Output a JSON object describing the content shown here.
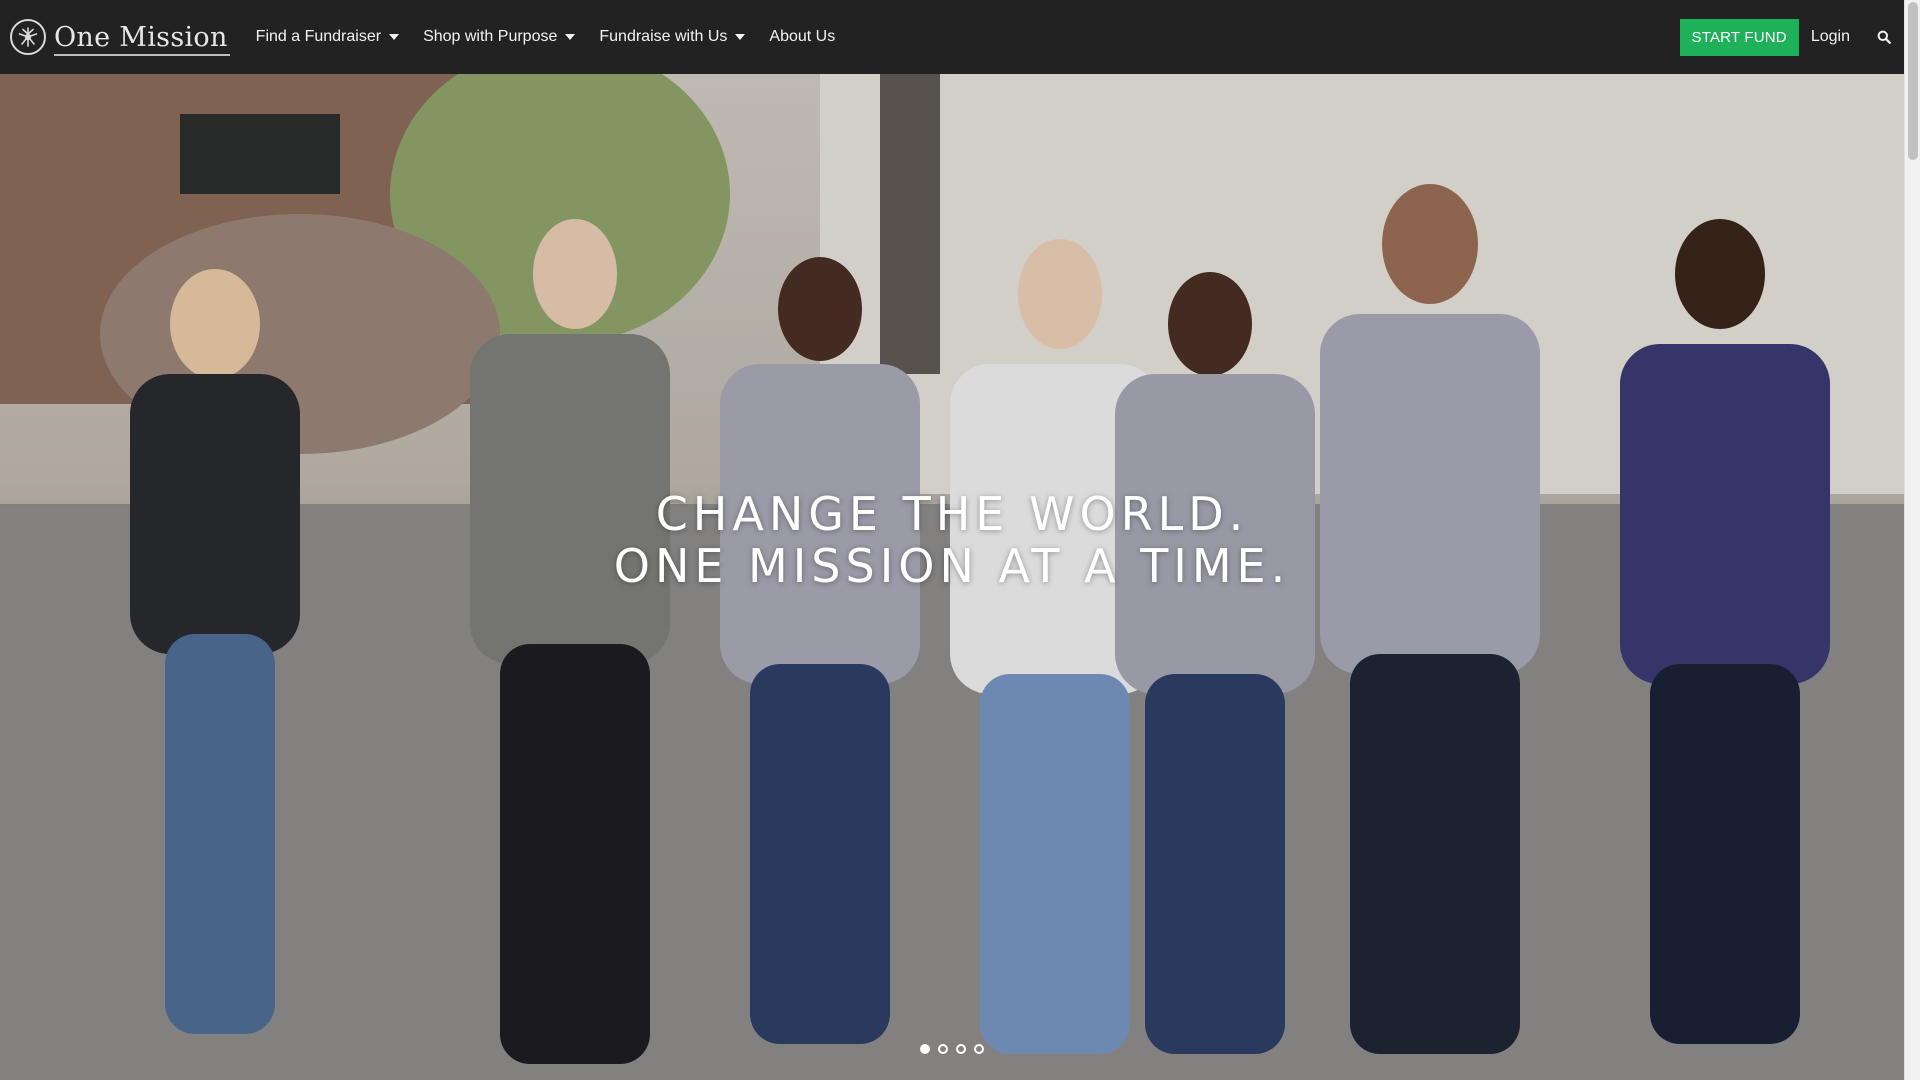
{
  "brand": {
    "name": "One Mission",
    "logo_icon": "tree-logo-icon"
  },
  "nav": {
    "items": [
      {
        "label": "Find a Fundraiser",
        "has_dropdown": true
      },
      {
        "label": "Shop with Purpose",
        "has_dropdown": true
      },
      {
        "label": "Fundraise with Us",
        "has_dropdown": true
      },
      {
        "label": "About Us",
        "has_dropdown": false
      }
    ],
    "start_fund_label": "START FUND",
    "login_label": "Login",
    "search_icon": "search-icon"
  },
  "hero": {
    "headline_line1": "CHANGE THE WORLD.",
    "headline_line2": "ONE MISSION AT A TIME.",
    "slides": {
      "count": 4,
      "active_index": 0
    }
  },
  "colors": {
    "header_bg": "#222222",
    "accent_green": "#1fb15a",
    "nav_text": "#f2f2f2"
  }
}
